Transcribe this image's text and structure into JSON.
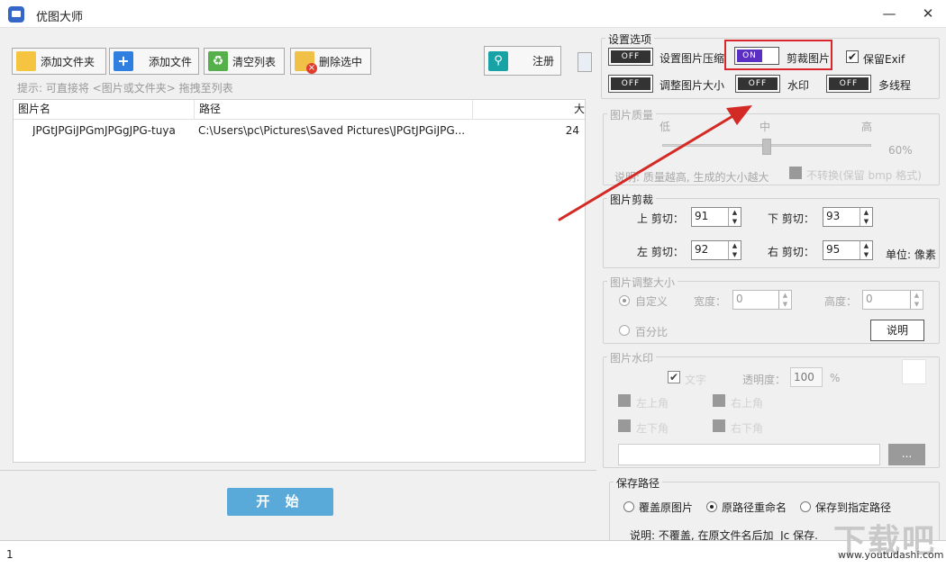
{
  "window": {
    "title": "优图大师",
    "minimize": "—",
    "close": "✕"
  },
  "toolbar": {
    "add_folder": "添加文件夹",
    "add_file": "添加文件",
    "clear_list": "清空列表",
    "delete_selected": "删除选中",
    "register": "注册"
  },
  "hint": "提示: 可直接将 <图片或文件夹> 拖拽至列表",
  "table": {
    "columns": [
      "图片名",
      "路径",
      "大"
    ],
    "rows": [
      {
        "name": "JPGtJPGiJPGmJPGgJPG-tuya",
        "path": "C:\\Users\\pc\\Pictures\\Saved Pictures\\JPGtJPGiJPG...",
        "size": "24"
      }
    ]
  },
  "start_button": "开 始",
  "settings": {
    "title": "设置选项",
    "compress": {
      "label": "设置图片压缩",
      "state": "OFF"
    },
    "crop": {
      "label": "剪裁图片",
      "state": "ON"
    },
    "keep_exif": {
      "label": "保留Exif",
      "checked": true
    },
    "resize": {
      "label": "调整图片大小",
      "state": "OFF"
    },
    "watermark": {
      "label": "水印",
      "state": "OFF"
    },
    "multithread": {
      "label": "多线程",
      "state": "OFF"
    }
  },
  "quality": {
    "title": "图片质量",
    "low": "低",
    "mid": "中",
    "high": "高",
    "percent": "60%",
    "note": "说明: 质量越高, 生成的大小越大",
    "no_convert": "不转换(保留 bmp 格式)",
    "level": 0.6
  },
  "crop": {
    "title": "图片剪裁",
    "top_label": "上 剪切：",
    "top": "91",
    "bottom_label": "下 剪切：",
    "bottom": "93",
    "left_label": "左 剪切：",
    "left": "92",
    "right_label": "右 剪切：",
    "right": "95",
    "unit": "单位: 像素"
  },
  "resize": {
    "title": "图片调整大小",
    "custom": "自定义",
    "width_label": "宽度：",
    "width": "0",
    "height_label": "高度：",
    "height": "0",
    "percent": "百分比",
    "explain_btn": "说明"
  },
  "watermark": {
    "title": "图片水印",
    "text_label": "文字",
    "opacity_label": "透明度：",
    "opacity": "100",
    "percent_sign": "%",
    "top_left": "左上角",
    "top_right": "右上角",
    "bottom_left": "左下角",
    "bottom_right": "右下角",
    "browse": "..."
  },
  "save_path": {
    "title": "保存路径",
    "overwrite": "覆盖原图片",
    "rename": "原路径重命名",
    "custom": "保存到指定路径",
    "note": "说明: 不覆盖, 在原文件名后加  Jc 保存."
  },
  "status": {
    "count": "1"
  },
  "watermark_site": {
    "logo": "下载吧",
    "url": "www.youtudashi.com"
  },
  "colors": {
    "accent_on": "#5a2fc2",
    "start": "#5aaad9",
    "highlight": "#d9262a",
    "arrow": "#d42a26"
  }
}
